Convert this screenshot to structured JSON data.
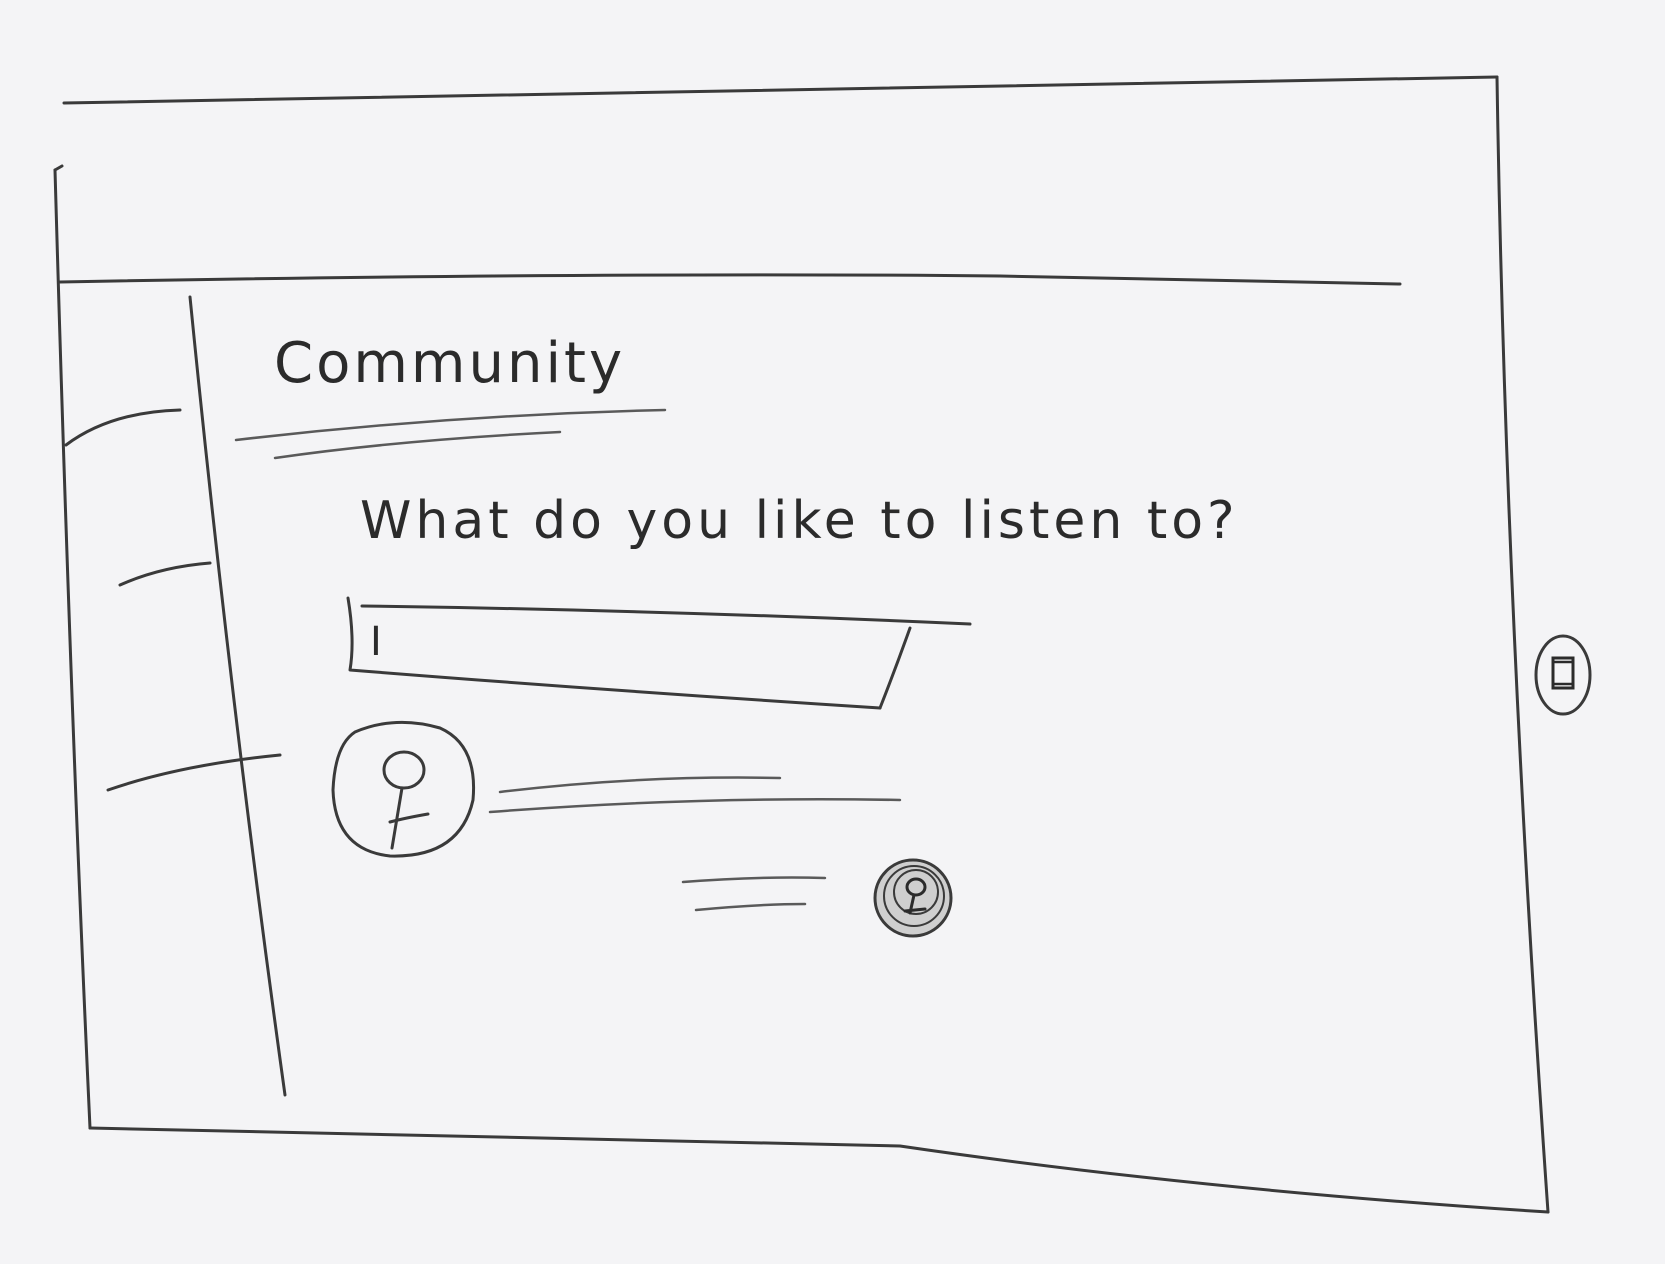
{
  "page": {
    "title": "Community"
  },
  "prompt": {
    "question": "What do you like to listen to?"
  },
  "answer_input": {
    "value": "I"
  },
  "icons": {
    "user_avatar": "user-avatar-icon",
    "reply_avatar": "reply-avatar-icon",
    "side_button": "phone-icon"
  }
}
